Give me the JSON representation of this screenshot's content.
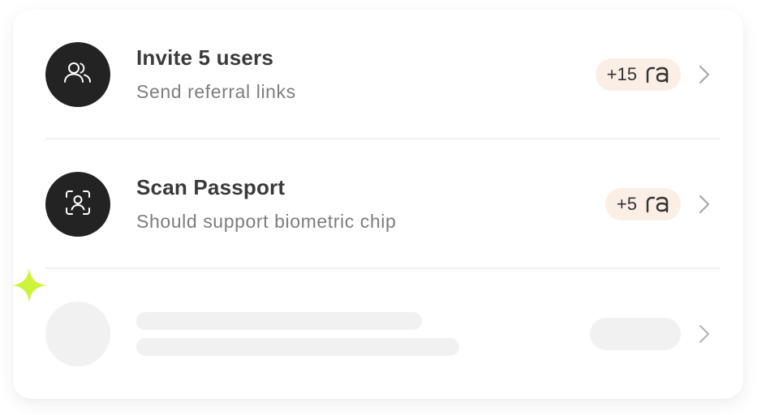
{
  "tasks": [
    {
      "title": "Invite 5 users",
      "subtitle": "Send referral links",
      "reward": "+15",
      "icon": "users-icon"
    },
    {
      "title": "Scan Passport",
      "subtitle": "Should support biometric chip",
      "reward": "+5",
      "icon": "face-scan-icon"
    }
  ],
  "loading_row": {
    "state": "skeleton"
  },
  "colors": {
    "avatar_bg": "#232323",
    "badge_bg": "#fbeee5",
    "skeleton": "#f1f1f1",
    "sparkle": "#ccf43a"
  }
}
